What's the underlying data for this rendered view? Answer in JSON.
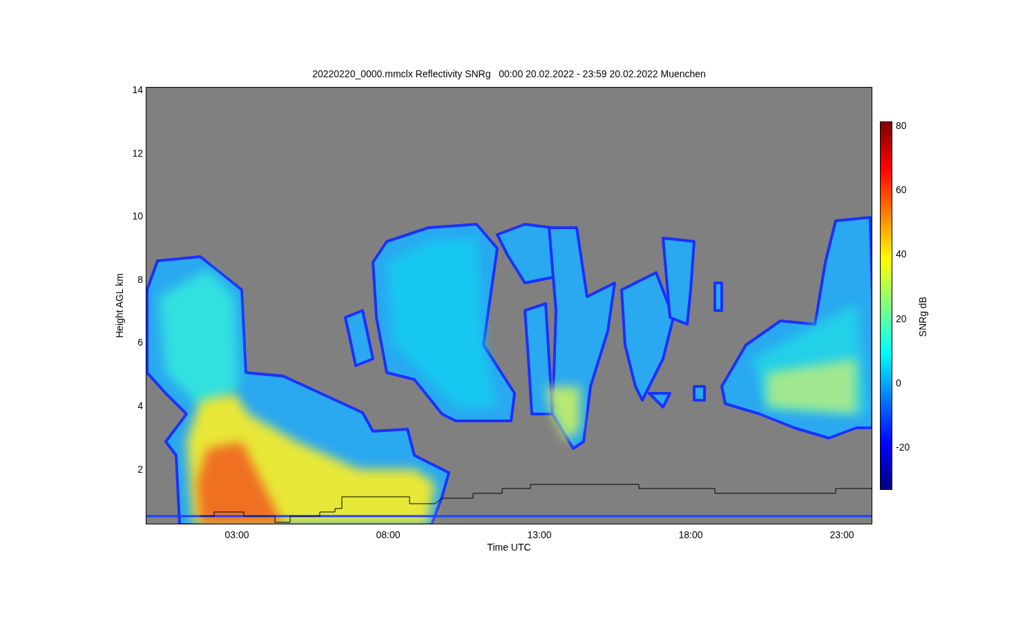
{
  "title": "20220220_0000.mmclx Reflectivity SNRg   00:00 20.02.2022 - 23:59 20.02.2022 Muenchen",
  "plot": {
    "ylabel": "Height AGL km",
    "xlabel": "Time UTC",
    "yticks": [
      "14",
      "12",
      "10",
      "8",
      "6",
      "4",
      "2"
    ],
    "xticks": [
      "03:00",
      "08:00",
      "13:00",
      "18:00",
      "23:00"
    ]
  },
  "colorbar": {
    "label": "SNRg dB",
    "ticks": [
      "80",
      "60",
      "40",
      "20",
      "0",
      "-20"
    ]
  }
}
